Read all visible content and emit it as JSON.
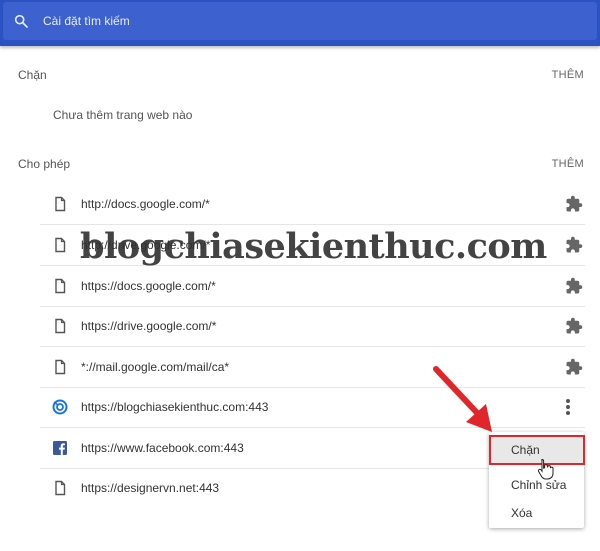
{
  "search": {
    "placeholder": "Cài đặt tìm kiếm"
  },
  "block_section": {
    "title": "Chặn",
    "add_label": "THÊM",
    "empty_text": "Chưa thêm trang web nào"
  },
  "allow_section": {
    "title": "Cho phép",
    "add_label": "THÊM",
    "sites": [
      {
        "url": "http://docs.google.com/*",
        "icon": "file-icon",
        "action": "extension-icon"
      },
      {
        "url": "http://drive.google.com/*",
        "icon": "file-icon",
        "action": "extension-icon"
      },
      {
        "url": "https://docs.google.com/*",
        "icon": "file-icon",
        "action": "extension-icon"
      },
      {
        "url": "https://drive.google.com/*",
        "icon": "file-icon",
        "action": "extension-icon"
      },
      {
        "url": "*://mail.google.com/mail/ca*",
        "icon": "file-icon",
        "action": "extension-icon"
      },
      {
        "url": "https://blogchiasekienthuc.com:443",
        "icon": "site-logo-icon",
        "action": "more-vert-icon"
      },
      {
        "url": "https://www.facebook.com:443",
        "icon": "facebook-icon",
        "action": ""
      },
      {
        "url": "https://designervn.net:443",
        "icon": "file-icon",
        "action": ""
      }
    ]
  },
  "context_menu": {
    "items": [
      "Chặn",
      "Chỉnh sửa",
      "Xóa"
    ]
  },
  "watermark": "blogchiasekienthuc.com",
  "colors": {
    "header": "#2b52c3",
    "highlight_border": "#e0262a",
    "facebook": "#3b5998",
    "site_logo": "#1a73e8"
  }
}
